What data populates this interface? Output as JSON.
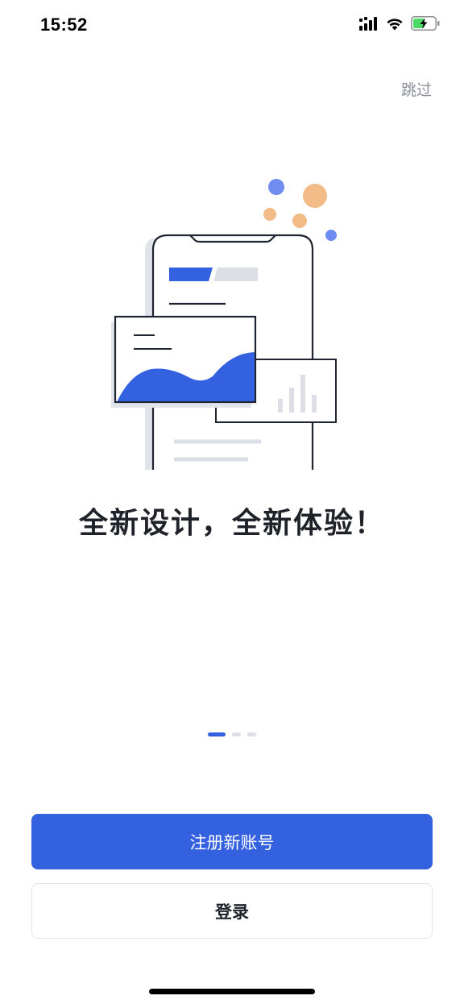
{
  "status_bar": {
    "time": "15:52",
    "icons": [
      "cellular-signal-icon",
      "wifi-icon",
      "battery-charging-icon"
    ]
  },
  "skip_label": "跳过",
  "illustration": {
    "name": "phone-with-charts-illustration"
  },
  "headline": "全新设计，全新体验！",
  "pager": {
    "total": 3,
    "current": 1
  },
  "buttons": {
    "register_label": "注册新账号",
    "login_label": "登录"
  },
  "colors": {
    "accent": "#3461df",
    "orange": "#f2bb88",
    "light_blue": "#6f8df0",
    "text_dark": "#1f2329",
    "text_muted": "#8a8f99",
    "outline": "#1e2530",
    "placeholder_gray": "#dcdfe6"
  }
}
